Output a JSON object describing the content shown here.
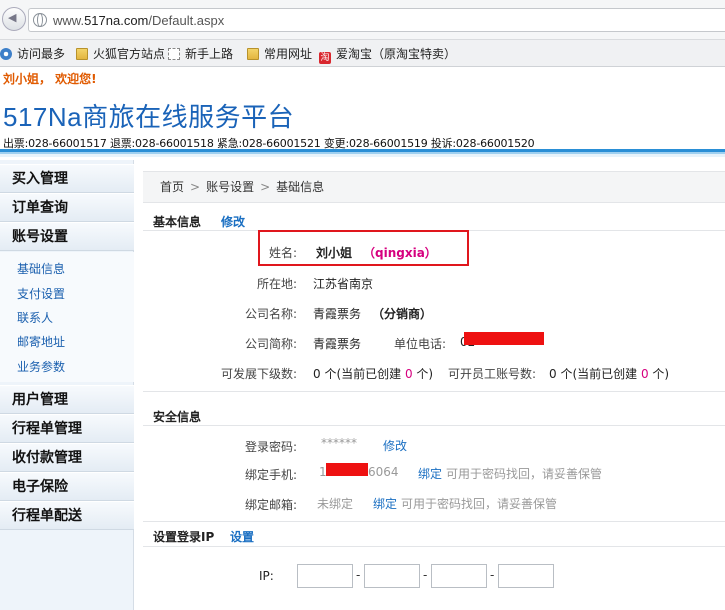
{
  "browser": {
    "url_prefix": "www.",
    "url_domain": "517na.com",
    "url_path": "/Default.aspx",
    "bookmarks": [
      {
        "label": "访问最多",
        "icon": "gear-icon"
      },
      {
        "label": "火狐官方站点",
        "icon": "folder-icon"
      },
      {
        "label": "新手上路",
        "icon": "page-icon"
      },
      {
        "label": "常用网址",
        "icon": "folder-icon"
      },
      {
        "label": "爱淘宝（原淘宝特卖）",
        "icon": "taobao-icon",
        "icon_char": "淘"
      }
    ]
  },
  "header": {
    "welcome": "刘小姐， 欢迎您!",
    "title": "517Na商旅在线服务平台",
    "phones": "出票:028-66001517 退票:028-66001518 紧急:028-66001521 变更:028-66001519 投诉:028-66001520"
  },
  "sidebar": {
    "groups": [
      {
        "label": "买入管理"
      },
      {
        "label": "订单查询"
      },
      {
        "label": "账号设置"
      }
    ],
    "sub_items": [
      "基础信息",
      "支付设置",
      "联系人",
      "邮寄地址",
      "业务参数"
    ],
    "groups_after": [
      {
        "label": "用户管理"
      },
      {
        "label": "行程单管理"
      },
      {
        "label": "收付款管理"
      },
      {
        "label": "电子保险"
      },
      {
        "label": "行程单配送"
      }
    ]
  },
  "breadcrumb": {
    "items": [
      "首页",
      "账号设置",
      "基础信息"
    ],
    "separator": ">"
  },
  "basic_info": {
    "title": "基本信息",
    "edit": "修改",
    "name_label": "姓名:",
    "name_value": "刘小姐",
    "login_id": "（qingxia）",
    "location_label": "所在地:",
    "location_value": "江苏省南京",
    "company_label": "公司名称:",
    "company_value": "青霞票务",
    "company_type": "（分销商）",
    "short_label": "公司简称:",
    "short_value": "青霞票务",
    "phone_label": "单位电话:",
    "phone_partial": "02",
    "sub_label": "可发展下级数:",
    "sub_value_prefix": "0 个(当前已创建 ",
    "sub_created": "0",
    "sub_value_suffix": " 个)",
    "staff_label": "可开员工账号数:",
    "staff_value_prefix": "0 个(当前已创建 ",
    "staff_created": "0",
    "staff_value_suffix": " 个)"
  },
  "security": {
    "title": "安全信息",
    "password_label": "登录密码:",
    "password_value": "******",
    "password_edit": "修改",
    "mobile_label": "绑定手机:",
    "mobile_start": "1",
    "mobile_end": "6064",
    "mobile_bind": "绑定",
    "mobile_hint": "可用于密码找回，请妥善保管",
    "email_label": "绑定邮箱:",
    "email_value": "未绑定",
    "email_bind": "绑定",
    "email_hint": "可用于密码找回，请妥善保管"
  },
  "ip_settings": {
    "title": "设置登录IP",
    "settings_link": "设置",
    "ip_label": "IP:",
    "ip_fields": [
      "",
      "",
      "",
      ""
    ]
  },
  "colors": {
    "accent_blue": "#1a63b8",
    "link_blue": "#1a6fc2",
    "welcome_orange": "#e05a00",
    "highlight_red": "#e0161d",
    "pink": "#d6007f"
  }
}
